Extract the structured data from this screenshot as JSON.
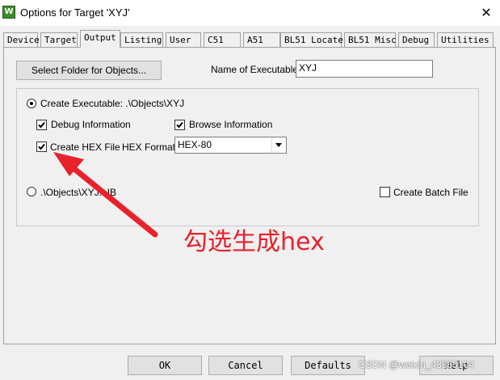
{
  "window": {
    "title": "Options for Target 'XYJ'",
    "app_icon": "keil-uvision-icon",
    "app_icon_glyph": "W",
    "close_glyph": "✕"
  },
  "tabs": [
    {
      "label": "Device",
      "active": false
    },
    {
      "label": "Target",
      "active": false
    },
    {
      "label": "Output",
      "active": true
    },
    {
      "label": "Listing",
      "active": false
    },
    {
      "label": "User",
      "active": false
    },
    {
      "label": "C51",
      "active": false
    },
    {
      "label": "A51",
      "active": false
    },
    {
      "label": "BL51 Locate",
      "active": false
    },
    {
      "label": "BL51 Misc",
      "active": false
    },
    {
      "label": "Debug",
      "active": false
    },
    {
      "label": "Utilities",
      "active": false
    }
  ],
  "output": {
    "select_folder_label": "Select Folder for Objects...",
    "name_of_executable_label": "Name of Executable:",
    "name_of_executable_value": "XYJ",
    "create_executable_label": "Create Executable:  .\\Objects\\XYJ",
    "create_executable_selected": true,
    "debug_information_label": "Debug Information",
    "debug_information_checked": true,
    "browse_information_label": "Browse Information",
    "browse_information_checked": true,
    "create_hex_label": "Create HEX File",
    "create_hex_checked": true,
    "hex_format_label": "HEX Format:",
    "hex_format_value": "HEX-80",
    "create_library_label": ".\\Objects\\XYJ.LIB",
    "create_library_selected": false,
    "create_batch_label": "Create Batch File",
    "create_batch_checked": false
  },
  "annotation": {
    "text": "勾选生成hex",
    "color": "#e8212b"
  },
  "buttons": {
    "ok": "OK",
    "cancel": "Cancel",
    "defaults": "Defaults",
    "help": "Help"
  },
  "watermark": "CSDN @weixin_43865104"
}
